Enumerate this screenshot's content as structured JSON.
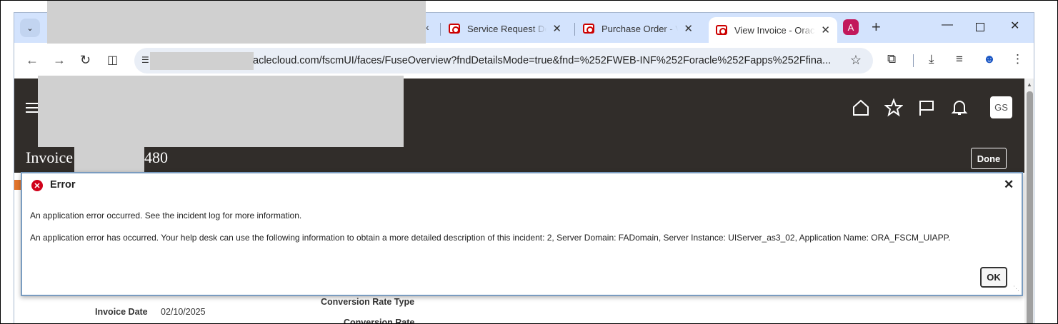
{
  "browser": {
    "tabs": [
      {
        "title": "Service Request Det",
        "active": false
      },
      {
        "title": "Purchase Order - View",
        "active": false
      },
      {
        "title": "View Invoice - Oracle",
        "active": true
      }
    ],
    "profile_letter": "A",
    "url": "aclecloud.com/fscmUI/faces/FuseOverview?fndDetailsMode=true&fnd=%252FWEB-INF%252Foracle%252Fapps%252Ffina..."
  },
  "app": {
    "user_initials": "GS",
    "page_title_prefix": "Invoice",
    "page_title_suffix": "480",
    "done_label": "Done",
    "background_fields": {
      "conversion_rate_type_label": "Conversion Rate Type",
      "conversion_rate_label": "Conversion Rate",
      "invoice_date_label": "Invoice Date",
      "invoice_date_value": "02/10/2025"
    }
  },
  "dialog": {
    "title": "Error",
    "message_1": "An application error occurred. See the incident log for more information.",
    "message_2": "An application error has occurred. Your help desk can use the following information to obtain a more detailed description of this incident: 2, Server Domain: FADomain, Server Instance: UIServer_as3_02, Application Name: ORA_FSCM_UIAPP.",
    "ok_label": "OK"
  },
  "colors": {
    "app_header": "#312d2a",
    "error_red": "#d0021b",
    "browser_chrome": "#d3e3fd"
  }
}
